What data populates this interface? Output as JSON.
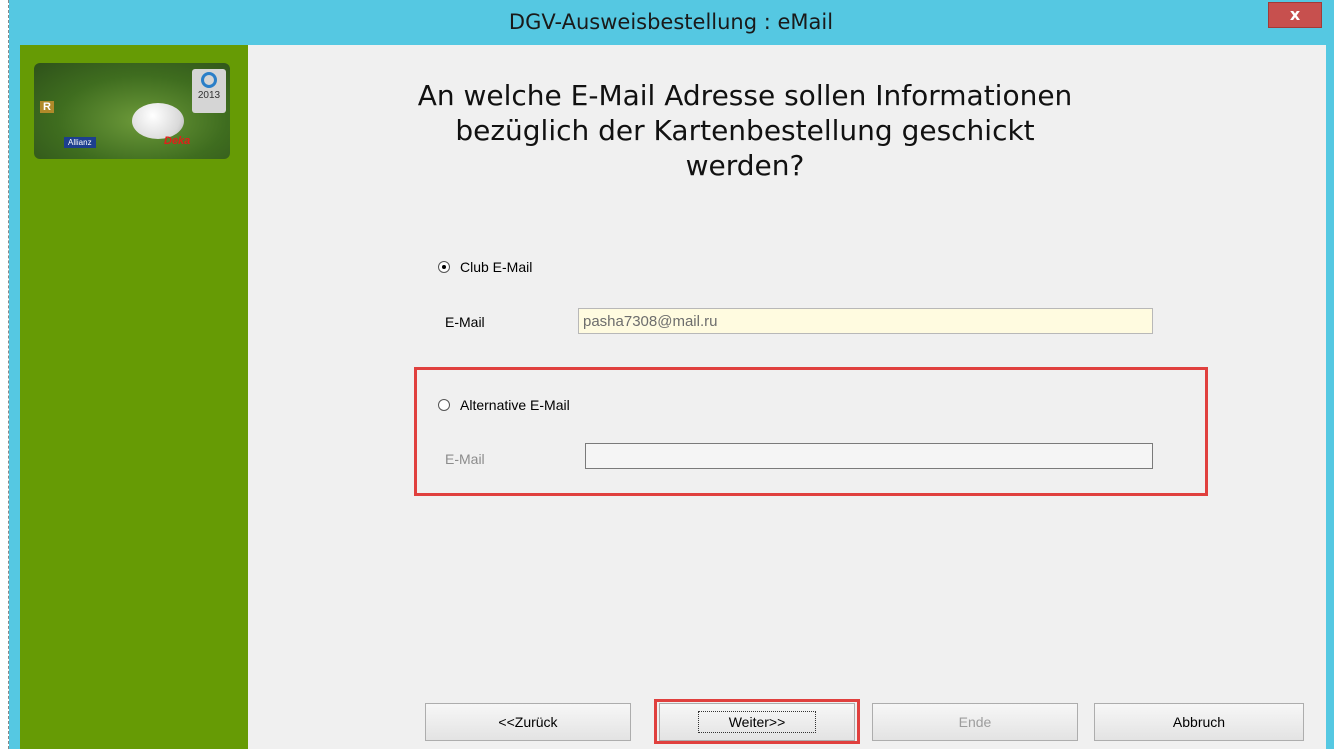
{
  "window": {
    "title": "DGV-Ausweisbestellung : eMail",
    "close_label": "x"
  },
  "logo": {
    "year": "2013",
    "r_label": "R",
    "allianz_label": "Allianz",
    "deka_label": "Deka"
  },
  "heading": {
    "line1": "An welche E-Mail Adresse sollen Informationen",
    "line2": "bezüglich der Kartenbestellung geschickt",
    "line3": "werden?"
  },
  "club_option": {
    "label": "Club E-Mail",
    "selected": true,
    "field_label": "E-Mail",
    "value": "pasha7308@mail.ru"
  },
  "alt_option": {
    "label": "Alternative E-Mail",
    "selected": false,
    "field_label": "E-Mail",
    "value": ""
  },
  "buttons": {
    "back": "<<Zurück",
    "next": "Weiter>>",
    "finish": "Ende",
    "cancel": "Abbruch"
  },
  "colors": {
    "titlebar": "#55c8e2",
    "sidebar": "#669b05",
    "highlight": "#e0403e",
    "close_button": "#c7504e"
  }
}
